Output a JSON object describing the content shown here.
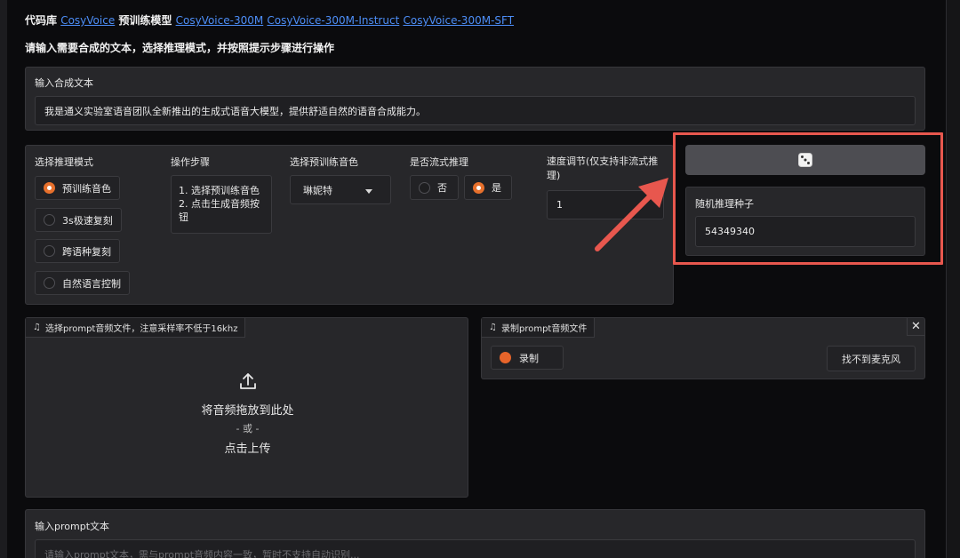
{
  "header": {
    "prefix": "代码库",
    "link_repo": "CosyVoice",
    "mid": "预训练模型",
    "link_model1": "CosyVoice-300M",
    "link_model2": "CosyVoice-300M-Instruct",
    "link_model3": "CosyVoice-300M-SFT",
    "instruction": "请输入需要合成的文本，选择推理模式，并按照提示步骤进行操作"
  },
  "tts_text": {
    "label": "输入合成文本",
    "value": "我是通义实验室语音团队全新推出的生成式语音大模型，提供舒适自然的语音合成能力。"
  },
  "mode": {
    "label": "选择推理模式",
    "options": [
      "预训练音色",
      "3s极速复刻",
      "跨语种复刻",
      "自然语言控制"
    ],
    "selected_index": 0
  },
  "steps": {
    "label": "操作步骤",
    "text": "1. 选择预训练音色\n2. 点击生成音频按钮"
  },
  "speaker": {
    "label": "选择预训练音色",
    "value": "琳妮特"
  },
  "stream": {
    "label": "是否流式推理",
    "options": [
      "否",
      "是"
    ],
    "selected_index": 1
  },
  "speed": {
    "label": "速度调节(仅支持非流式推理)",
    "value": "1"
  },
  "seed": {
    "button_icon": "dice-icon",
    "label": "随机推理种子",
    "value": "54349340"
  },
  "upload": {
    "tag": "选择prompt音频文件，注意采样率不低于16khz",
    "drop_text": "将音频拖放到此处",
    "or_text": "- 或 -",
    "click_text": "点击上传"
  },
  "record": {
    "tag": "录制prompt音频文件",
    "record_label": "录制",
    "no_mic_label": "找不到麦克风"
  },
  "prompt_text": {
    "label": "输入prompt文本",
    "placeholder": "请输入prompt文本，需与prompt音频内容一致，暂时不支持自动识别..."
  },
  "colors": {
    "accent": "#e7702c",
    "link": "#4d8ef7",
    "annotation": "#e8574e"
  }
}
